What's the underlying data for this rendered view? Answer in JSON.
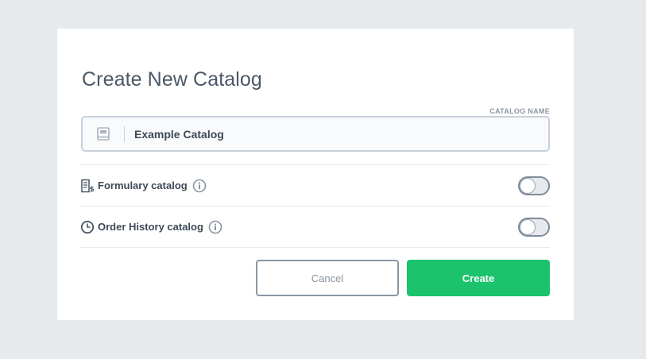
{
  "dialog": {
    "title": "Create New Catalog",
    "catalog_name": {
      "label": "CATALOG NAME",
      "value": "Example Catalog",
      "icon": "book-icon"
    },
    "options": [
      {
        "label": "Formulary catalog",
        "icon": "formulary-icon",
        "enabled": false
      },
      {
        "label": "Order History catalog",
        "icon": "clock-icon",
        "enabled": false
      }
    ],
    "buttons": {
      "cancel_label": "Cancel",
      "create_label": "Create"
    }
  },
  "colors": {
    "background": "#e6eaed",
    "accent": "#1bc36d",
    "text": "#3d4a57",
    "muted": "#8a96a2"
  }
}
